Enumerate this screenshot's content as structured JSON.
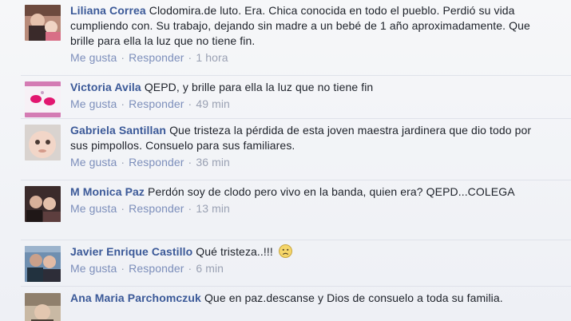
{
  "comments": [
    {
      "author": "Liliana Correa",
      "text": "Clodomira.de luto. Era. Chica conocida en todo el pueblo. Perdió su vida cumpliendo con. Su trabajo, dejando sin madre a un bebé de 1 año aproximadamente. Que brille para ella la luz que no tiene fin.",
      "like": "Me gusta",
      "reply": "Responder",
      "time": "1 hora"
    },
    {
      "author": "Victoria Avila",
      "text": "QEPD, y brille para ella la luz que no tiene fin",
      "like": "Me gusta",
      "reply": "Responder",
      "time": "49 min"
    },
    {
      "author": "Gabriela Santillan",
      "text": "Que tristeza la pérdida de esta joven maestra jardinera que dio todo por sus pimpollos. Consuelo para sus familiares.",
      "like": "Me gusta",
      "reply": "Responder",
      "time": "36 min"
    },
    {
      "author": "M Monica Paz",
      "text": "Perdón soy de clodo pero vivo en la banda, quien era? QEPD...COLEGA",
      "like": "Me gusta",
      "reply": "Responder",
      "time": "13 min"
    },
    {
      "author": "Javier Enrique Castillo",
      "text": "Qué tristeza..!!!",
      "emoji": "sad-face-icon",
      "like": "Me gusta",
      "reply": "Responder",
      "time": "6 min"
    },
    {
      "author": "Ana Maria Parchomczuk",
      "text": "Que en paz.descanse y Dios de consuelo a toda su familia."
    }
  ],
  "separator": "·"
}
